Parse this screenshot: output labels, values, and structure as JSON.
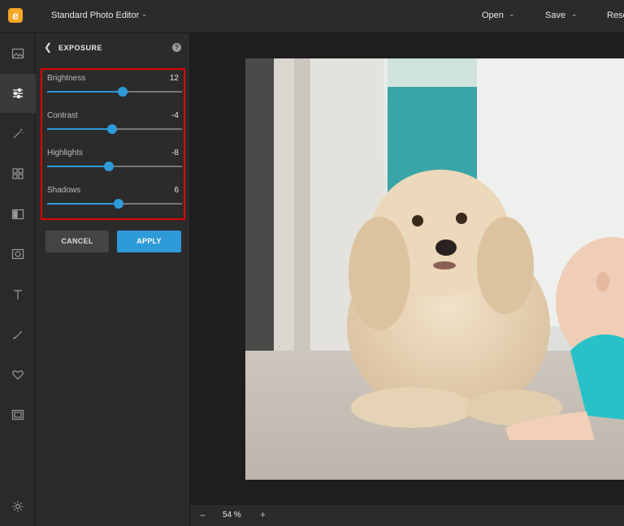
{
  "header": {
    "app_title": "Standard Photo Editor",
    "menu": [
      {
        "label": "Open"
      },
      {
        "label": "Save"
      },
      {
        "label": "Rese"
      }
    ]
  },
  "toolbar": {
    "tools": [
      {
        "icon": "image-icon"
      },
      {
        "icon": "adjust-sliders-icon",
        "active": true
      },
      {
        "icon": "magic-wand-icon"
      },
      {
        "icon": "grid-icon"
      },
      {
        "icon": "overlay-icon"
      },
      {
        "icon": "frame-icon"
      },
      {
        "icon": "text-icon"
      },
      {
        "icon": "brush-icon"
      },
      {
        "icon": "heart-icon"
      },
      {
        "icon": "border-icon"
      },
      {
        "icon": "settings-icon"
      }
    ]
  },
  "panel": {
    "title": "EXPOSURE",
    "sliders": [
      {
        "label": "Brightness",
        "value": "12",
        "fraction": 0.56
      },
      {
        "label": "Contrast",
        "value": "-4",
        "fraction": 0.48
      },
      {
        "label": "Highlights",
        "value": "-8",
        "fraction": 0.46
      },
      {
        "label": "Shadows",
        "value": "6",
        "fraction": 0.53
      }
    ],
    "cancel_label": "CANCEL",
    "apply_label": "APPLY"
  },
  "bottom": {
    "zoom_minus": "−",
    "zoom_value": "54 %",
    "zoom_plus": "+"
  },
  "colors": {
    "accent": "#2f9ad8",
    "highlight_border": "#e00000"
  }
}
